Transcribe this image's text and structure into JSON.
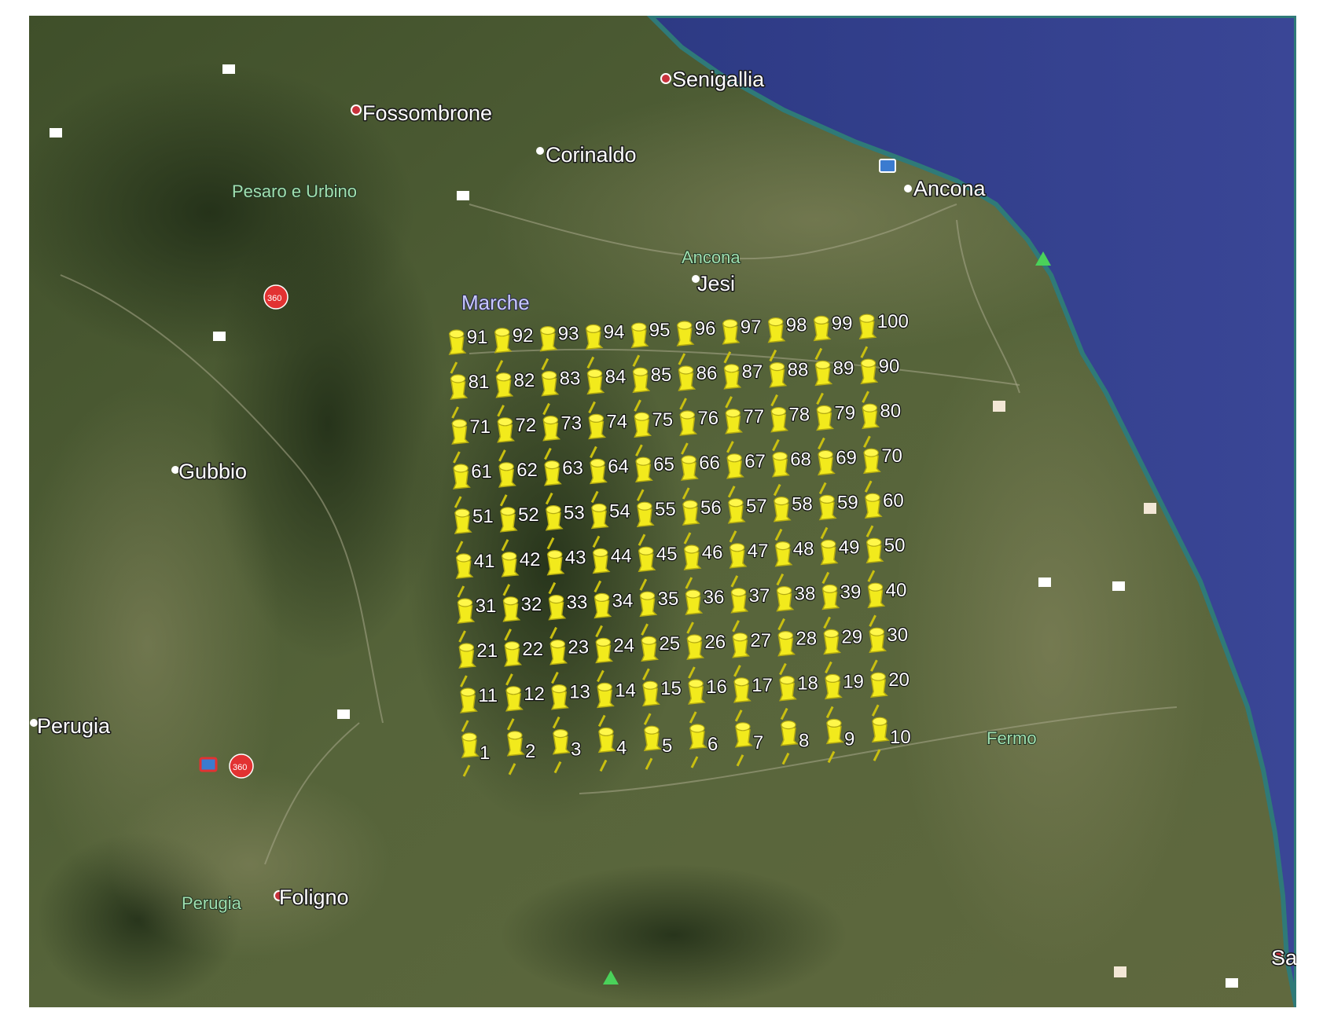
{
  "map": {
    "places": [
      {
        "name": "Senigallia",
        "icon": "city-pin-icon"
      },
      {
        "name": "Fossombrone",
        "icon": "city-pin-icon"
      },
      {
        "name": "Corinaldo",
        "icon": "city-pin-icon"
      },
      {
        "name": "Ancona",
        "icon": "city-pin-icon"
      },
      {
        "name": "Jesi",
        "icon": "city-pin-icon"
      },
      {
        "name": "Gubbio",
        "icon": "city-pin-icon"
      },
      {
        "name": "Perugia",
        "icon": "city-pin-icon"
      },
      {
        "name": "Foligno",
        "icon": "city-pin-icon"
      },
      {
        "name": "Sa",
        "icon": "city-pin-icon"
      }
    ],
    "regions": [
      {
        "name": "Pesaro e Urbino"
      },
      {
        "name": "Ancona"
      },
      {
        "name": "Marche"
      },
      {
        "name": "Fermo"
      },
      {
        "name": "Perugia"
      }
    ],
    "pushpins": {
      "icon": "yellow-pushpin-icon",
      "color": "#f2ea1c",
      "labels": [
        "1",
        "2",
        "3",
        "4",
        "5",
        "6",
        "7",
        "8",
        "9",
        "10",
        "11",
        "12",
        "13",
        "14",
        "15",
        "16",
        "17",
        "18",
        "19",
        "20",
        "21",
        "22",
        "23",
        "24",
        "25",
        "26",
        "27",
        "28",
        "29",
        "30",
        "31",
        "32",
        "33",
        "34",
        "35",
        "36",
        "37",
        "38",
        "39",
        "40",
        "41",
        "42",
        "43",
        "44",
        "45",
        "46",
        "47",
        "48",
        "49",
        "50",
        "51",
        "52",
        "53",
        "54",
        "55",
        "56",
        "57",
        "58",
        "59",
        "60",
        "61",
        "62",
        "63",
        "64",
        "65",
        "66",
        "67",
        "68",
        "69",
        "70",
        "71",
        "72",
        "73",
        "74",
        "75",
        "76",
        "77",
        "78",
        "79",
        "80",
        "81",
        "82",
        "83",
        "84",
        "85",
        "86",
        "87",
        "88",
        "89",
        "90",
        "91",
        "92",
        "93",
        "94",
        "95",
        "96",
        "97",
        "98",
        "99",
        "100"
      ]
    },
    "colors": {
      "sea": "#2f3c86",
      "land": "#4d5b31",
      "pushpin": "#f2ea1c",
      "coast": "#2f7a78"
    },
    "poi_icons": [
      "museum-icon",
      "hotel-icon",
      "photo-icon",
      "360-photo-icon",
      "park-icon"
    ]
  }
}
